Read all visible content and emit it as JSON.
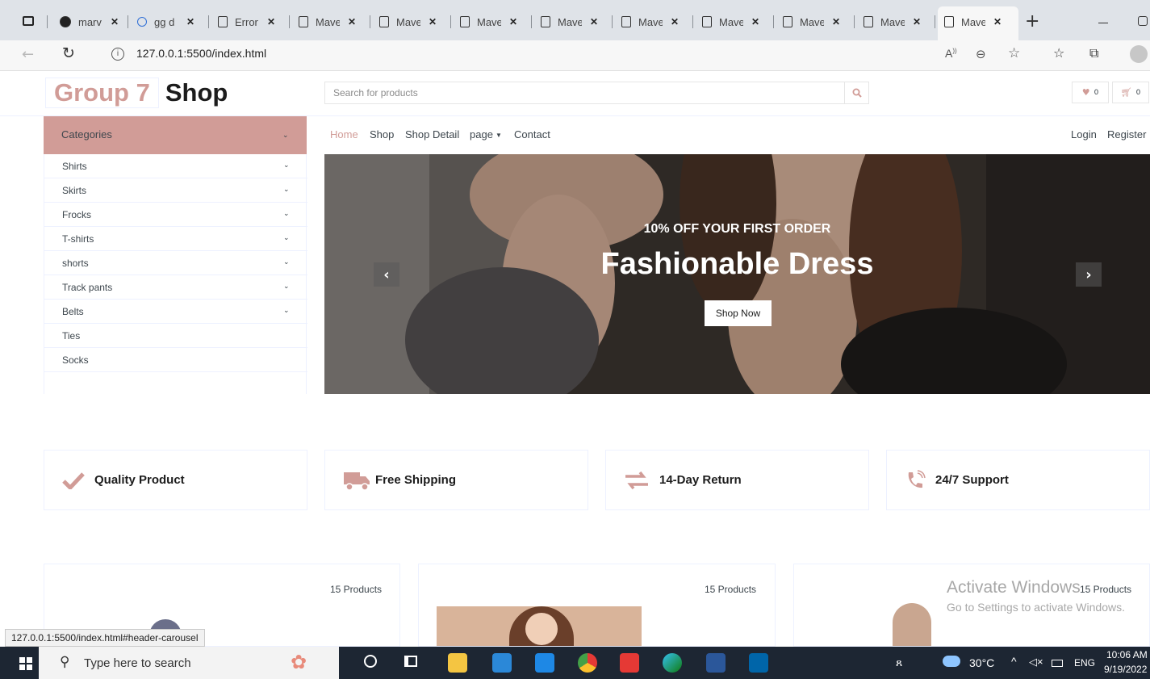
{
  "browser": {
    "tabs": [
      {
        "title": "marv",
        "icon": "github-icon"
      },
      {
        "title": "gg d",
        "icon": "search-icon"
      },
      {
        "title": "Error",
        "icon": "page-icon"
      },
      {
        "title": "Mave",
        "icon": "page-icon"
      },
      {
        "title": "Mave",
        "icon": "page-icon"
      },
      {
        "title": "Mave",
        "icon": "page-icon"
      },
      {
        "title": "Mave",
        "icon": "page-icon"
      },
      {
        "title": "Mave",
        "icon": "page-icon"
      },
      {
        "title": "Mave",
        "icon": "page-icon"
      },
      {
        "title": "Mave",
        "icon": "page-icon"
      },
      {
        "title": "Mave",
        "icon": "page-icon"
      },
      {
        "title": "Mave",
        "icon": "page-icon",
        "active": true
      }
    ],
    "url": "127.0.0.1:5500/index.html"
  },
  "site": {
    "logo_part1": "Group 7",
    "logo_part2": "Shop",
    "search_placeholder": "Search for products",
    "wishlist_count": "0",
    "cart_count": "0",
    "accent_color": "#D19C97"
  },
  "categories": {
    "title": "Categories",
    "items": [
      {
        "label": "Shirts",
        "has_dropdown": true
      },
      {
        "label": "Skirts",
        "has_dropdown": true
      },
      {
        "label": "Frocks",
        "has_dropdown": true
      },
      {
        "label": "T-shirts",
        "has_dropdown": true
      },
      {
        "label": "shorts",
        "has_dropdown": true
      },
      {
        "label": "Track pants",
        "has_dropdown": true
      },
      {
        "label": "Belts",
        "has_dropdown": true
      },
      {
        "label": "Ties",
        "has_dropdown": false
      },
      {
        "label": "Socks",
        "has_dropdown": false
      }
    ]
  },
  "nav": {
    "links": [
      "Home",
      "Shop",
      "Shop Detail",
      "page",
      "Contact"
    ],
    "active": "Home",
    "login": "Login",
    "register": "Register"
  },
  "carousel": {
    "subtitle": "10% OFF YOUR FIRST ORDER",
    "title": "Fashionable Dress",
    "button": "Shop Now"
  },
  "features": [
    {
      "label": "Quality Product",
      "icon": "check-icon"
    },
    {
      "label": "Free Shipping",
      "icon": "truck-icon"
    },
    {
      "label": "14-Day Return",
      "icon": "exchange-icon"
    },
    {
      "label": "24/7 Support",
      "icon": "phone-icon"
    }
  ],
  "product_cards": [
    {
      "count": "15 Products"
    },
    {
      "count": "15 Products"
    },
    {
      "count": "15 Products"
    }
  ],
  "status_url": "127.0.0.1:5500/index.html#header-carousel",
  "watermark": {
    "line1": "Activate Windows",
    "line2": "Go to Settings to activate Windows."
  },
  "taskbar": {
    "search_placeholder": "Type here to search",
    "weather": "30°C",
    "language": "ENG",
    "time": "10:06 AM",
    "date": "9/19/2022"
  }
}
